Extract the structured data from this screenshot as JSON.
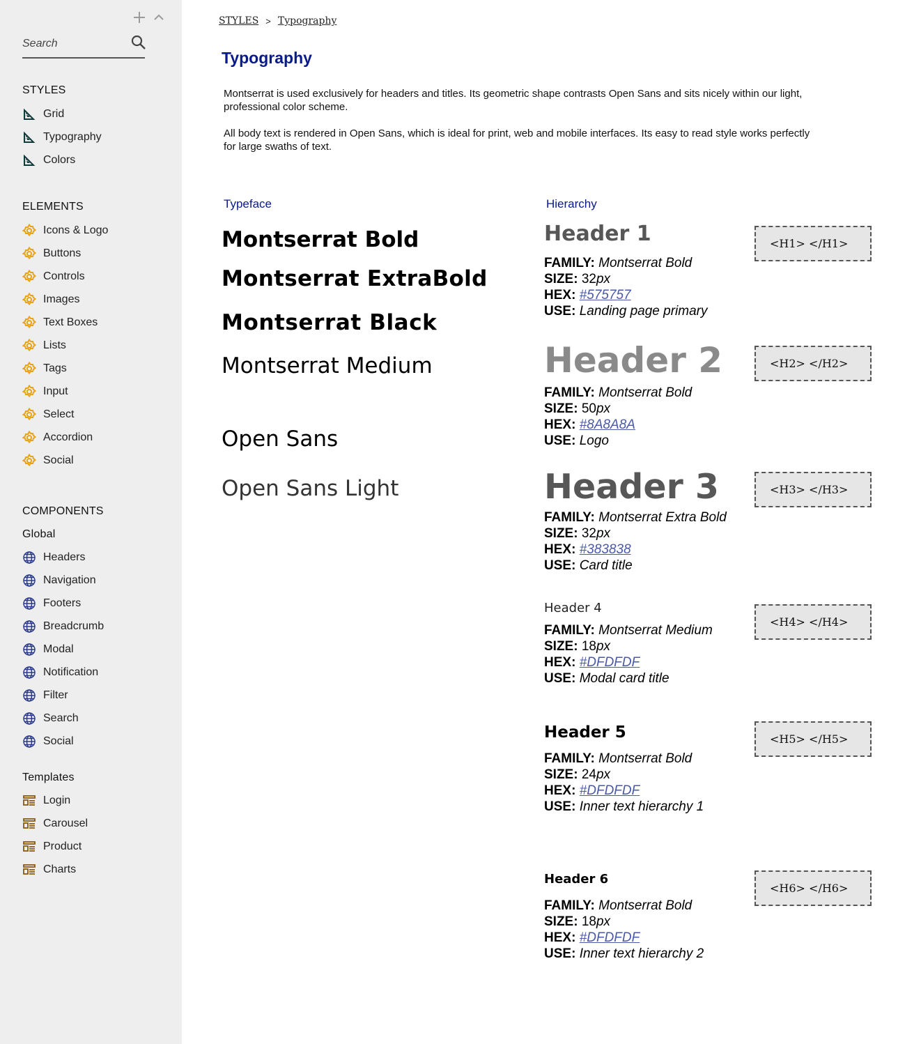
{
  "sidebar": {
    "search_placeholder": "Search",
    "sections": {
      "styles": "STYLES",
      "elements": "ELEMENTS",
      "components": "COMPONENTS",
      "global": "Global",
      "templates": "Templates"
    },
    "styles_items": [
      "Grid",
      "Typography",
      "Colors"
    ],
    "elements_items": [
      "Icons & Logo",
      "Buttons",
      "Controls",
      "Images",
      "Text Boxes",
      "Lists",
      "Tags",
      "Input",
      "Select",
      "Accordion",
      "Social"
    ],
    "global_items": [
      "Headers",
      "Navigation",
      "Footers",
      "Breadcrumb",
      "Modal",
      "Notification",
      "Filter",
      "Search",
      "Social"
    ],
    "template_items": [
      "Login",
      "Carousel",
      "Product",
      "Charts"
    ]
  },
  "breadcrumb": {
    "root": "STYLES",
    "separator": ">",
    "current": "Typography"
  },
  "page_title": "Typography",
  "paragraphs": [
    "Montserrat is used exclusively for headers and titles. Its geometric shape contrasts Open Sans and sits nicely within our light, professional color scheme.",
    "All body text is rendered in Open Sans, which is ideal for print, web and mobile interfaces. Its easy to read style works perfectly for large swaths of text."
  ],
  "typeface": {
    "heading": "Typeface",
    "samples": [
      "Montserrat Bold",
      "Montserrat ExtraBold",
      "Montserrat Black",
      "Montserrat Medium",
      "Open Sans",
      "Open Sans Light"
    ]
  },
  "hierarchy": {
    "heading": "Hierarchy",
    "labels": {
      "family": "FAMILY:",
      "size": "SIZE:",
      "hex": "HEX:",
      "use": "USE:"
    },
    "items": [
      {
        "title": "Header 1",
        "family": "Montserrat Bold",
        "size_num": "32",
        "size_unit": "px",
        "hex": "#575757",
        "use": "Landing page primary",
        "tag": "<H1> </H1>",
        "color": "#575757"
      },
      {
        "title": "Header 2",
        "family": "Montserrat Bold",
        "size_num": "50",
        "size_unit": "px",
        "hex": "#8A8A8A",
        "use": "Logo",
        "tag": "<H2> </H2>",
        "color": "#8a8a8a"
      },
      {
        "title": "Header 3",
        "family": "Montserrat Extra Bold",
        "size_num": "32",
        "size_unit": "px",
        "hex": "#383838",
        "use": "Card title",
        "tag": "<H3> </H3>",
        "color": "#575757"
      },
      {
        "title": "Header 4",
        "family": "Montserrat Medium",
        "size_num": "18",
        "size_unit": "px",
        "hex": "#DFDFDF",
        "use": "Modal card title",
        "tag": "<H4> </H4>",
        "color": "#222222"
      },
      {
        "title": "Header 5",
        "family": "Montserrat Bold",
        "size_num": "24",
        "size_unit": "px",
        "hex": "#DFDFDF",
        "use": "Inner text hierarchy 1",
        "tag": "<H5> </H5>",
        "color": "#000000"
      },
      {
        "title": "Header 6",
        "family": "Montserrat Bold",
        "size_num": "18",
        "size_unit": "px",
        "hex": "#DFDFDF",
        "use": "Inner text hierarchy 2",
        "tag": "<H6> </H6>",
        "color": "#000000"
      }
    ]
  },
  "colors": {
    "accent_blue": "#0a1a8c",
    "link": "#4a59a8",
    "sidebar_bg": "#eeeeee",
    "element_icon": "#e8a317",
    "global_icon": "#2b3a8c",
    "template_icon": "#8a5a12",
    "style_icon": "#0f3a3a"
  }
}
